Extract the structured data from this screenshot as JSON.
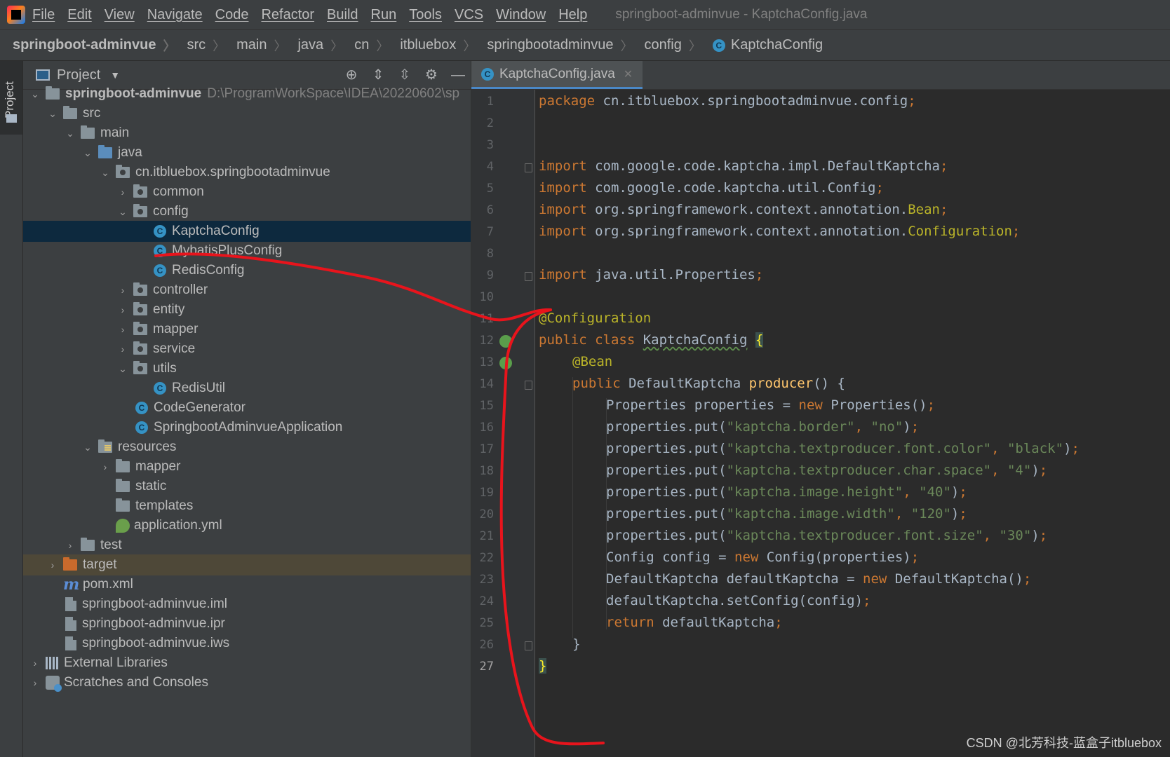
{
  "menubar": {
    "items": [
      "File",
      "Edit",
      "View",
      "Navigate",
      "Code",
      "Refactor",
      "Build",
      "Run",
      "Tools",
      "VCS",
      "Window",
      "Help"
    ],
    "window_title": "springboot-adminvue - KaptchaConfig.java"
  },
  "breadcrumbs": [
    "springboot-adminvue",
    "src",
    "main",
    "java",
    "cn",
    "itbluebox",
    "springbootadminvue",
    "config",
    "KaptchaConfig"
  ],
  "side_strip": {
    "label": "Project"
  },
  "project_panel": {
    "title": "Project",
    "tree": [
      {
        "label": "springboot-adminvue",
        "hint": "D:\\ProgramWorkSpace\\IDEA\\20220602\\sp"
      },
      {
        "label": "src"
      },
      {
        "label": "main"
      },
      {
        "label": "java"
      },
      {
        "label": "cn.itbluebox.springbootadminvue"
      },
      {
        "label": "common"
      },
      {
        "label": "config"
      },
      {
        "label": "KaptchaConfig"
      },
      {
        "label": "MybatisPlusConfig"
      },
      {
        "label": "RedisConfig"
      },
      {
        "label": "controller"
      },
      {
        "label": "entity"
      },
      {
        "label": "mapper"
      },
      {
        "label": "service"
      },
      {
        "label": "utils"
      },
      {
        "label": "RedisUtil"
      },
      {
        "label": "CodeGenerator"
      },
      {
        "label": "SpringbootAdminvueApplication"
      },
      {
        "label": "resources"
      },
      {
        "label": "mapper"
      },
      {
        "label": "static"
      },
      {
        "label": "templates"
      },
      {
        "label": "application.yml"
      },
      {
        "label": "test"
      },
      {
        "label": "target"
      },
      {
        "label": "pom.xml"
      },
      {
        "label": "springboot-adminvue.iml"
      },
      {
        "label": "springboot-adminvue.ipr"
      },
      {
        "label": "springboot-adminvue.iws"
      },
      {
        "label": "External Libraries"
      },
      {
        "label": "Scratches and Consoles"
      }
    ]
  },
  "editor": {
    "tab_label": "KaptchaConfig.java",
    "line_numbers": [
      "1",
      "2",
      "3",
      "4",
      "5",
      "6",
      "7",
      "8",
      "9",
      "10",
      "11",
      "12",
      "13",
      "14",
      "15",
      "16",
      "17",
      "18",
      "19",
      "20",
      "21",
      "22",
      "23",
      "24",
      "25",
      "26",
      "27"
    ],
    "code": {
      "l1_kw": "package",
      "l1_rest": " cn.itbluebox.springbootadminvue.config",
      "l4_kw": "import",
      "l4_rest": " com.google.code.kaptcha.impl.DefaultKaptcha",
      "l5_kw": "import",
      "l5_rest": " com.google.code.kaptcha.util.Config",
      "l6_kw": "import",
      "l6_rest": " org.springframework.context.annotation.",
      "l6_hl": "Bean",
      "l7_kw": "import",
      "l7_rest": " org.springframework.context.annotation.",
      "l7_hl": "Configuration",
      "l9_kw": "import",
      "l9_rest": " java.util.Properties",
      "semi": ";",
      "l11_ann": "@Configuration",
      "l12_kw": "public class ",
      "l12_name": "KaptchaConfig",
      "l12_brace": "{",
      "l13_ann": "@Bean",
      "l14_kw": "public ",
      "l14_type": "DefaultKaptcha ",
      "l14_fn": "producer",
      "l14_rest": "() {",
      "l15_a": "Properties properties = ",
      "l15_new": "new",
      "l15_b": " Properties()",
      "put_prefix": "properties.put(",
      "comma": ", ",
      "close_paren": ")",
      "l16_key": "\"kaptcha.border\"",
      "l16_val": "\"no\"",
      "l17_key": "\"kaptcha.textproducer.font.color\"",
      "l17_val": "\"black\"",
      "l18_key": "\"kaptcha.textproducer.char.space\"",
      "l18_val": "\"4\"",
      "l19_key": "\"kaptcha.image.height\"",
      "l19_val": "\"40\"",
      "l20_key": "\"kaptcha.image.width\"",
      "l20_val": "\"120\"",
      "l21_key": "\"kaptcha.textproducer.font.size\"",
      "l21_val": "\"30\"",
      "l22_a": "Config config = ",
      "l22_new": "new",
      "l22_b": " Config(properties)",
      "l23_a": "DefaultKaptcha defaultKaptcha = ",
      "l23_new": "new",
      "l23_b": " DefaultKaptcha()",
      "l24": "defaultKaptcha.setConfig(config)",
      "l25_kw": "return",
      "l25_rest": " defaultKaptcha",
      "l26": "}",
      "l27": "}"
    }
  },
  "watermark": "CSDN @北芳科技-蓝盒子itbluebox",
  "colors": {
    "keyword": "#cc7832",
    "string": "#6a8759",
    "annotation": "#bbb529",
    "method": "#ffc66d",
    "selection": "#0d293e",
    "scribble": "#e8141c"
  }
}
